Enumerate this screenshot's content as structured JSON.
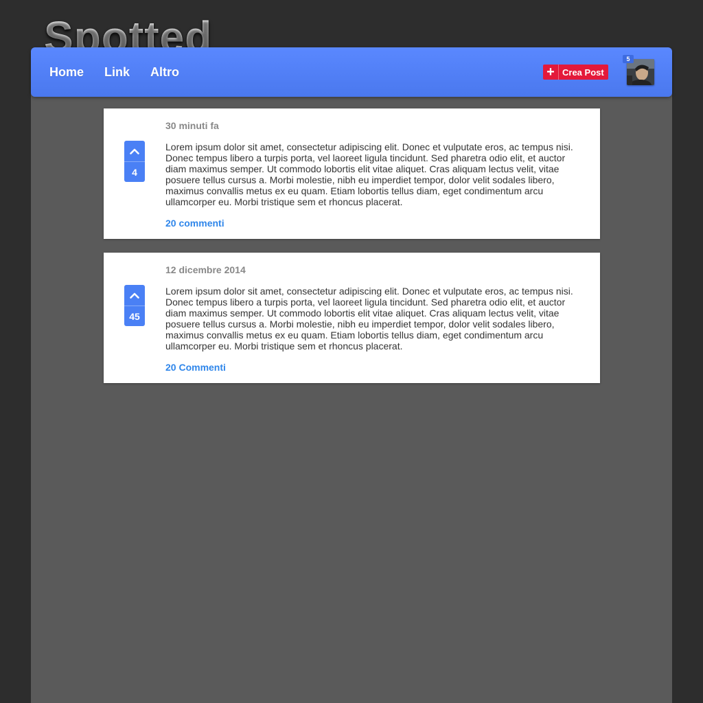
{
  "app": {
    "logo_text": "Spotted"
  },
  "nav": {
    "links": [
      "Home",
      "Link",
      "Altro"
    ],
    "create_post_label": "Crea Post",
    "notification_count": "5"
  },
  "posts": [
    {
      "date": "30 minuti fa",
      "votes": "4",
      "body": "Lorem ipsum dolor sit amet, consectetur adipiscing elit. Donec et vulputate eros, ac tempus nisi. Donec tempus libero a turpis porta, vel laoreet ligula tincidunt. Sed pharetra odio elit, et auctor diam maximus semper. Ut commodo lobortis elit vitae aliquet. Cras aliquam lectus velit, vitae posuere tellus cursus a. Morbi molestie, nibh eu imperdiet tempor, dolor velit sodales libero, maximus convallis metus ex eu quam. Etiam lobortis tellus diam, eget condimentum arcu ullamcorper eu. Morbi tristique sem et rhoncus placerat.",
      "comments": "20 commenti"
    },
    {
      "date": "12 dicembre 2014",
      "votes": "45",
      "body": "Lorem ipsum dolor sit amet, consectetur adipiscing elit. Donec et vulputate eros, ac tempus nisi. Donec tempus libero a turpis porta, vel laoreet ligula tincidunt. Sed pharetra odio elit, et auctor diam maximus semper. Ut commodo lobortis elit vitae aliquet. Cras aliquam lectus velit, vitae posuere tellus cursus a. Morbi molestie, nibh eu imperdiet tempor, dolor velit sodales libero, maximus convallis metus ex eu quam. Etiam lobortis tellus diam, eget condimentum arcu ullamcorper eu. Morbi tristique sem et rhoncus placerat.",
      "comments": "20 Commenti"
    }
  ],
  "colors": {
    "navbar": "#5080ff",
    "create_post": "#e4193a",
    "vote": "#4a80f5",
    "link": "#2f86ea"
  },
  "icons": {
    "create_post": "plus-icon",
    "upvote": "chevron-up-icon"
  }
}
